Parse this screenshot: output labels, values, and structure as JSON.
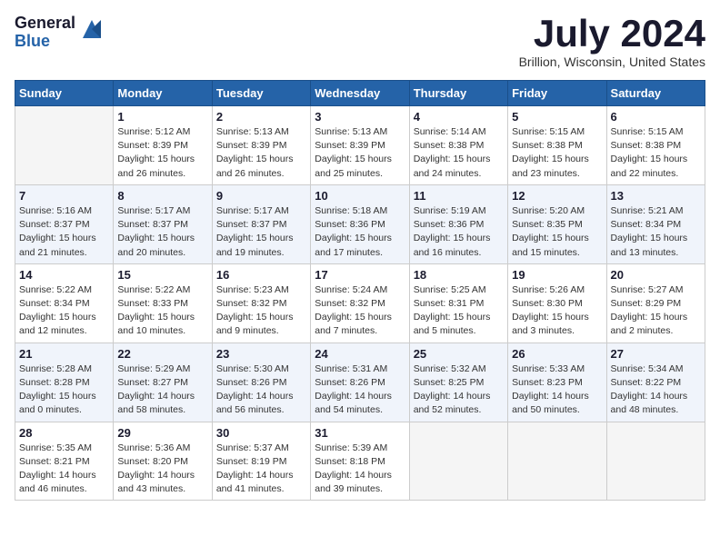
{
  "header": {
    "logo_general": "General",
    "logo_blue": "Blue",
    "month_title": "July 2024",
    "location": "Brillion, Wisconsin, United States"
  },
  "calendar": {
    "days_of_week": [
      "Sunday",
      "Monday",
      "Tuesday",
      "Wednesday",
      "Thursday",
      "Friday",
      "Saturday"
    ],
    "weeks": [
      [
        {
          "num": "",
          "info": ""
        },
        {
          "num": "1",
          "info": "Sunrise: 5:12 AM\nSunset: 8:39 PM\nDaylight: 15 hours\nand 26 minutes."
        },
        {
          "num": "2",
          "info": "Sunrise: 5:13 AM\nSunset: 8:39 PM\nDaylight: 15 hours\nand 26 minutes."
        },
        {
          "num": "3",
          "info": "Sunrise: 5:13 AM\nSunset: 8:39 PM\nDaylight: 15 hours\nand 25 minutes."
        },
        {
          "num": "4",
          "info": "Sunrise: 5:14 AM\nSunset: 8:38 PM\nDaylight: 15 hours\nand 24 minutes."
        },
        {
          "num": "5",
          "info": "Sunrise: 5:15 AM\nSunset: 8:38 PM\nDaylight: 15 hours\nand 23 minutes."
        },
        {
          "num": "6",
          "info": "Sunrise: 5:15 AM\nSunset: 8:38 PM\nDaylight: 15 hours\nand 22 minutes."
        }
      ],
      [
        {
          "num": "7",
          "info": "Sunrise: 5:16 AM\nSunset: 8:37 PM\nDaylight: 15 hours\nand 21 minutes."
        },
        {
          "num": "8",
          "info": "Sunrise: 5:17 AM\nSunset: 8:37 PM\nDaylight: 15 hours\nand 20 minutes."
        },
        {
          "num": "9",
          "info": "Sunrise: 5:17 AM\nSunset: 8:37 PM\nDaylight: 15 hours\nand 19 minutes."
        },
        {
          "num": "10",
          "info": "Sunrise: 5:18 AM\nSunset: 8:36 PM\nDaylight: 15 hours\nand 17 minutes."
        },
        {
          "num": "11",
          "info": "Sunrise: 5:19 AM\nSunset: 8:36 PM\nDaylight: 15 hours\nand 16 minutes."
        },
        {
          "num": "12",
          "info": "Sunrise: 5:20 AM\nSunset: 8:35 PM\nDaylight: 15 hours\nand 15 minutes."
        },
        {
          "num": "13",
          "info": "Sunrise: 5:21 AM\nSunset: 8:34 PM\nDaylight: 15 hours\nand 13 minutes."
        }
      ],
      [
        {
          "num": "14",
          "info": "Sunrise: 5:22 AM\nSunset: 8:34 PM\nDaylight: 15 hours\nand 12 minutes."
        },
        {
          "num": "15",
          "info": "Sunrise: 5:22 AM\nSunset: 8:33 PM\nDaylight: 15 hours\nand 10 minutes."
        },
        {
          "num": "16",
          "info": "Sunrise: 5:23 AM\nSunset: 8:32 PM\nDaylight: 15 hours\nand 9 minutes."
        },
        {
          "num": "17",
          "info": "Sunrise: 5:24 AM\nSunset: 8:32 PM\nDaylight: 15 hours\nand 7 minutes."
        },
        {
          "num": "18",
          "info": "Sunrise: 5:25 AM\nSunset: 8:31 PM\nDaylight: 15 hours\nand 5 minutes."
        },
        {
          "num": "19",
          "info": "Sunrise: 5:26 AM\nSunset: 8:30 PM\nDaylight: 15 hours\nand 3 minutes."
        },
        {
          "num": "20",
          "info": "Sunrise: 5:27 AM\nSunset: 8:29 PM\nDaylight: 15 hours\nand 2 minutes."
        }
      ],
      [
        {
          "num": "21",
          "info": "Sunrise: 5:28 AM\nSunset: 8:28 PM\nDaylight: 15 hours\nand 0 minutes."
        },
        {
          "num": "22",
          "info": "Sunrise: 5:29 AM\nSunset: 8:27 PM\nDaylight: 14 hours\nand 58 minutes."
        },
        {
          "num": "23",
          "info": "Sunrise: 5:30 AM\nSunset: 8:26 PM\nDaylight: 14 hours\nand 56 minutes."
        },
        {
          "num": "24",
          "info": "Sunrise: 5:31 AM\nSunset: 8:26 PM\nDaylight: 14 hours\nand 54 minutes."
        },
        {
          "num": "25",
          "info": "Sunrise: 5:32 AM\nSunset: 8:25 PM\nDaylight: 14 hours\nand 52 minutes."
        },
        {
          "num": "26",
          "info": "Sunrise: 5:33 AM\nSunset: 8:23 PM\nDaylight: 14 hours\nand 50 minutes."
        },
        {
          "num": "27",
          "info": "Sunrise: 5:34 AM\nSunset: 8:22 PM\nDaylight: 14 hours\nand 48 minutes."
        }
      ],
      [
        {
          "num": "28",
          "info": "Sunrise: 5:35 AM\nSunset: 8:21 PM\nDaylight: 14 hours\nand 46 minutes."
        },
        {
          "num": "29",
          "info": "Sunrise: 5:36 AM\nSunset: 8:20 PM\nDaylight: 14 hours\nand 43 minutes."
        },
        {
          "num": "30",
          "info": "Sunrise: 5:37 AM\nSunset: 8:19 PM\nDaylight: 14 hours\nand 41 minutes."
        },
        {
          "num": "31",
          "info": "Sunrise: 5:39 AM\nSunset: 8:18 PM\nDaylight: 14 hours\nand 39 minutes."
        },
        {
          "num": "",
          "info": ""
        },
        {
          "num": "",
          "info": ""
        },
        {
          "num": "",
          "info": ""
        }
      ]
    ]
  }
}
